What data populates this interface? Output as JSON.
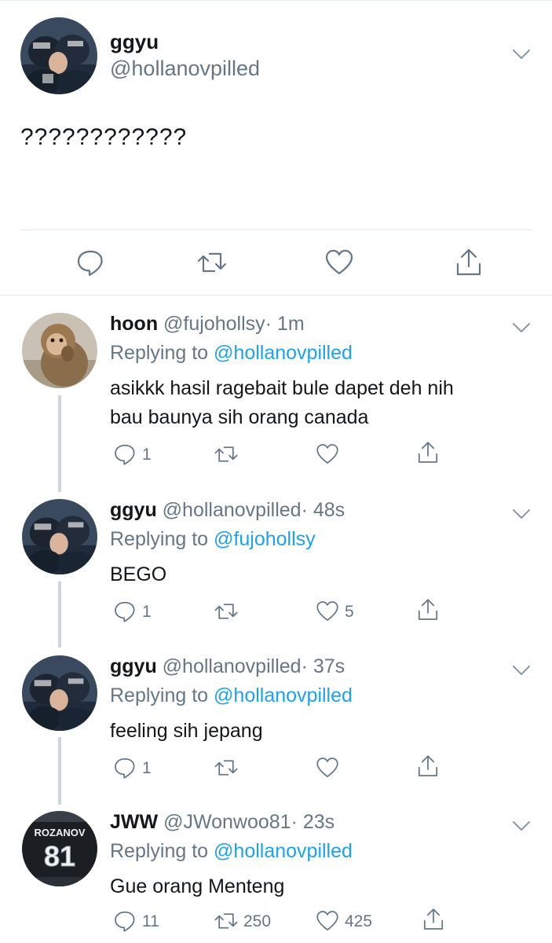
{
  "main_tweet": {
    "name": "ggyu",
    "handle": "@hollanovpilled",
    "text": "????????????",
    "actions": [
      "reply-icon",
      "retweet-icon",
      "like-icon",
      "share-icon"
    ]
  },
  "replies": [
    {
      "name": "hoon",
      "handle": "@fujohollsy",
      "time": "· 1m",
      "replying_prefix": "Replying to ",
      "replying_to": "@hollanovpilled",
      "text_lines": [
        "asikkk hasil ragebait bule dapet deh nih",
        "bau baunya sih orang canada"
      ],
      "counts": {
        "reply": "1",
        "retweet": "",
        "like": ""
      }
    },
    {
      "name": "ggyu",
      "handle": "@hollanovpilled",
      "time": "· 48s",
      "replying_prefix": "Replying to ",
      "replying_to": "@fujohollsy",
      "text_lines": [
        "BEGO"
      ],
      "counts": {
        "reply": "1",
        "retweet": "",
        "like": "5"
      }
    },
    {
      "name": "ggyu",
      "handle": "@hollanovpilled",
      "time": "· 37s",
      "replying_prefix": "Replying to ",
      "replying_to": "@hollanovpilled",
      "text_lines": [
        "feeling sih jepang"
      ],
      "counts": {
        "reply": "1",
        "retweet": "",
        "like": ""
      }
    },
    {
      "name": "JWW",
      "handle": "@JWonwoo81",
      "time": "· 23s",
      "replying_prefix": "Replying to ",
      "replying_to": "@hollanovpilled",
      "text_lines": [
        "Gue orang Menteng"
      ],
      "counts": {
        "reply": "11",
        "retweet": "250",
        "like": "425"
      },
      "avatar_text": [
        "ROZANOV",
        "81"
      ]
    }
  ],
  "colors": {
    "accent": "#1da1f2",
    "secondary_text": "#657786",
    "text": "#14171a",
    "divider": "#e1e8ed",
    "thread_line": "#ccd6dd"
  }
}
